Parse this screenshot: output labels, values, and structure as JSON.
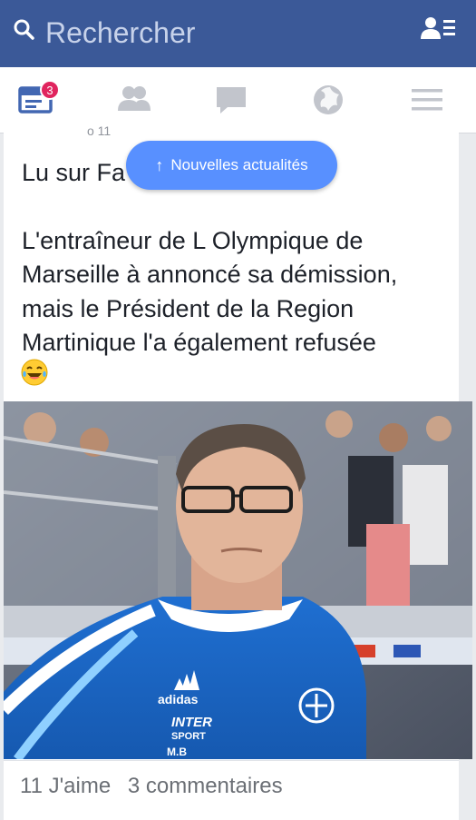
{
  "search": {
    "placeholder": "Rechercher"
  },
  "nav": {
    "badge_count": "3",
    "items": [
      {
        "name": "news-feed",
        "icon": "news-feed-icon"
      },
      {
        "name": "friends",
        "icon": "friends-icon"
      },
      {
        "name": "messages",
        "icon": "chat-icon"
      },
      {
        "name": "notifications",
        "icon": "globe-icon"
      },
      {
        "name": "menu",
        "icon": "menu-icon"
      }
    ]
  },
  "new_stories": {
    "label": "Nouvelles actualités",
    "arrow": "↑"
  },
  "post": {
    "meta_clipped": "o 11",
    "line1": "Lu sur Fa",
    "body": "L'entraîneur de L Olympique de Marseille à annoncé sa démission, mais le Président de la Region Martinique l'a également refusée",
    "emoji": "laughing-tears-emoji",
    "photo_jersey_brand": "adidas",
    "photo_jersey_sponsor_1": "INTER",
    "photo_jersey_sponsor_2": "SPORT",
    "photo_jersey_initials": "M.B",
    "likes": "11 J'aime",
    "comments": "3 commentaires"
  },
  "colors": {
    "topbar": "#3b5998",
    "pill": "#5890ff",
    "badge": "#e0245e",
    "text": "#1d2129"
  }
}
